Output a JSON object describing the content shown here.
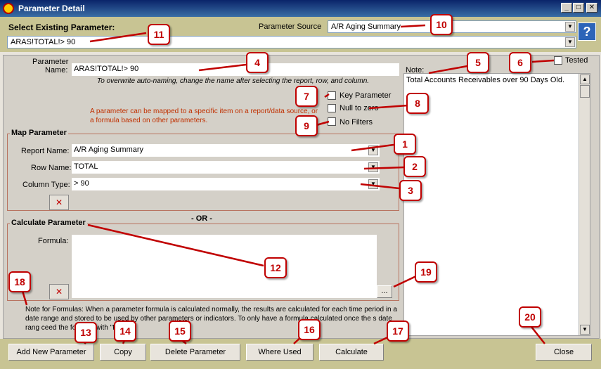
{
  "window": {
    "title": "Parameter Detail",
    "min": "_",
    "max": "□",
    "close": "✕"
  },
  "header": {
    "select_label": "Select Existing Parameter:",
    "source_label": "Parameter Source",
    "source_value": "A/R Aging Summary",
    "existing_value": "ARAS!TOTAL!> 90",
    "help": "?"
  },
  "param": {
    "name_label_1": "Parameter",
    "name_label_2": "Name:",
    "name_value": "ARAS!TOTAL!> 90",
    "hint": "To overwrite auto-naming, change the name after selecting the report, row, and column.",
    "mapping_note": "A parameter can be mapped to a specific item on a report/data source, or a formula based on other parameters.",
    "key_param": "Key Parameter",
    "null_zero": "Null to zero",
    "no_filters": "No Filters",
    "tested": "Tested",
    "note_label": "Note:",
    "note_value": "Total Accounts Receivables over 90 Days Old."
  },
  "map": {
    "title": "Map Parameter",
    "report_label": "Report Name:",
    "report_value": "A/R Aging Summary",
    "row_label": "Row Name:",
    "row_value": "TOTAL",
    "col_label": "Column Type:",
    "col_value": "> 90",
    "or": "- OR -"
  },
  "calc": {
    "title": "Calculate Parameter",
    "formula_label": "Formula:",
    "ellipsis": "...",
    "formula_note": "Note for Formulas: When a parameter formula is calculated normally, the results are calculated for each time period in a date range and stored to be used by other parameters or indicators.  To only have a formula calculated once the s          date rang          ceed the formula with \"Ratio:\""
  },
  "buttons": {
    "add": "Add New Parameter",
    "copy": "Copy",
    "delete": "Delete Parameter",
    "where": "Where Used",
    "calculate": "Calculate",
    "close": "Close"
  },
  "callouts": [
    "1",
    "2",
    "3",
    "4",
    "5",
    "6",
    "7",
    "8",
    "9",
    "10",
    "11",
    "12",
    "13",
    "14",
    "15",
    "16",
    "17",
    "18",
    "19",
    "20"
  ],
  "icons": {
    "clear": "✕",
    "arrow": "▼",
    "scroll_up": "▲",
    "scroll_down": "▼"
  }
}
